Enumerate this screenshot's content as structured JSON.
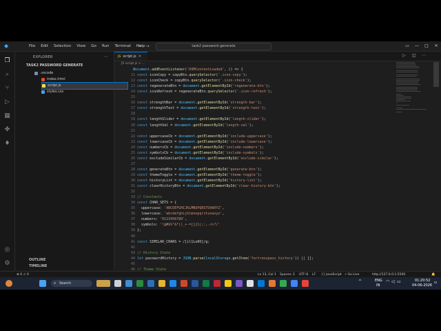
{
  "titlebar": {
    "menus": [
      "File",
      "Edit",
      "Selection",
      "View",
      "Go",
      "Run",
      "Terminal",
      "Help"
    ],
    "search_text": "task2 password generate"
  },
  "sidebar": {
    "title": "EXPLORER",
    "folder": "TASK2 PASSWORD GENERATE",
    "files": [
      {
        "name": ".vscode",
        "icon": "folder",
        "color": "#7a8ea6"
      },
      {
        "name": "index.html",
        "icon": "html",
        "color": "#e44d26"
      },
      {
        "name": "script.js",
        "icon": "js",
        "color": "#f1dd3f"
      },
      {
        "name": "styles.css",
        "icon": "css",
        "color": "#42a5f5"
      }
    ],
    "outline": "OUTLINE",
    "timeline": "TIMELINE"
  },
  "editor": {
    "tab_label": "script.js",
    "breadcrumb": "JS  script.js  >  ...",
    "lines": [
      {
        "n": "8",
        "t": "document.addEventListener('DOMContentLoaded', () => {"
      },
      {
        "n": "11",
        "t": "  const iconCopy = copyBtn.querySelector('.icon-copy');"
      },
      {
        "n": "12",
        "t": "  const iconCheck = copyBtn.querySelector('.icon-check');"
      },
      {
        "n": "13",
        "t": "  const regenerateBtn = document.getElementById('regenerate-btn');"
      },
      {
        "n": "14",
        "t": "  const iconRefresh = regenerateBtn.querySelector('.icon-refresh');"
      },
      {
        "n": "15",
        "t": ""
      },
      {
        "n": "16",
        "t": "  const strengthBar = document.getElementById('strength-bar');"
      },
      {
        "n": "17",
        "t": "  const strengthText = document.getElementById('strength-text');"
      },
      {
        "n": "18",
        "t": ""
      },
      {
        "n": "19",
        "t": "  const lengthSlider = document.getElementById('length-slider');"
      },
      {
        "n": "20",
        "t": "  const lengthVal = document.getElementById('length-val');"
      },
      {
        "n": "21",
        "t": ""
      },
      {
        "n": "22",
        "t": "  const uppercaseCb = document.getElementById('include-uppercase');"
      },
      {
        "n": "23",
        "t": "  const lowercaseCb = document.getElementById('include-lowercase');"
      },
      {
        "n": "24",
        "t": "  const numbersCb = document.getElementById('include-numbers');"
      },
      {
        "n": "25",
        "t": "  const symbolsCb = document.getElementById('include-symbols');"
      },
      {
        "n": "26",
        "t": "  const excludeSimilarCb = document.getElementById('exclude-similar');"
      },
      {
        "n": "27",
        "t": ""
      },
      {
        "n": "28",
        "t": "  const generateBtn = document.getElementById('generate-btn');"
      },
      {
        "n": "29",
        "t": "  const themeToggle = document.getElementById('theme-toggle');"
      },
      {
        "n": "30",
        "t": "  const historyList = document.getElementById('history-list');"
      },
      {
        "n": "31",
        "t": "  const clearHistoryBtn = document.getElementById('clear-history-btn');"
      },
      {
        "n": "32",
        "t": ""
      },
      {
        "n": "33",
        "t": "  // Constants"
      },
      {
        "n": "34",
        "t": "  const CHAR_SETS = {"
      },
      {
        "n": "35",
        "t": "    uppercase: 'ABCDEFGHIJKLMNOPQRSTUVWXYZ',"
      },
      {
        "n": "36",
        "t": "    lowercase: 'abcdefghijklmnopqrstuvwxyz',"
      },
      {
        "n": "37",
        "t": "    numbers: '0123456789',"
      },
      {
        "n": "38",
        "t": "    symbols: '!@#$%^&*()_+-=[]{}|;:,.<>?/'"
      },
      {
        "n": "39",
        "t": "  };"
      },
      {
        "n": "40",
        "t": ""
      },
      {
        "n": "41",
        "t": "  const SIMILAR_CHARS = /[il1Lo0O]/g;"
      },
      {
        "n": "42",
        "t": ""
      },
      {
        "n": "43",
        "t": "  // History State"
      },
      {
        "n": "44",
        "t": "  let passwordHistory = JSON.parse(localStorage.getItem('fortresspass_history')) || [];"
      },
      {
        "n": "45",
        "t": ""
      },
      {
        "n": "46",
        "t": "  // Theme State"
      }
    ]
  },
  "statusbar": {
    "left": "⊗ 0  ⚠ 0",
    "position": "Ln 13, Col 1",
    "spaces": "Spaces: 2",
    "encoding": "UTF-8",
    "eol": "LF",
    "language": "{} JavaScript",
    "golive": "⚡ Go Live",
    "port": "http://127.0.0.1:5500"
  },
  "taskbar": {
    "search": "Search",
    "lang": "ENG",
    "region": "IN",
    "time": "01:20:52",
    "date": "04-06-2026"
  }
}
